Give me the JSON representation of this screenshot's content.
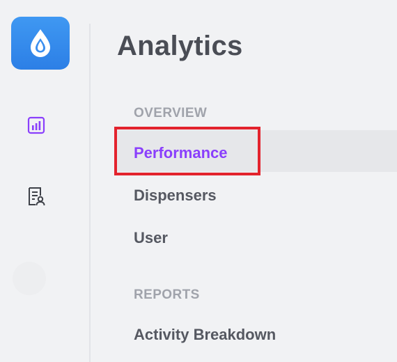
{
  "rail": {
    "icons": [
      {
        "name": "droplet-logo-icon"
      },
      {
        "name": "analytics-chart-icon",
        "color": "#8a3ffc"
      },
      {
        "name": "report-user-icon"
      }
    ]
  },
  "nav": {
    "title": "Analytics",
    "sections": [
      {
        "header": "OVERVIEW",
        "items": [
          {
            "label": "Performance",
            "active": true
          },
          {
            "label": "Dispensers"
          },
          {
            "label": "User"
          }
        ]
      },
      {
        "header": "REPORTS",
        "items": [
          {
            "label": "Activity Breakdown"
          }
        ]
      }
    ]
  },
  "colors": {
    "accent": "#8a3ffc",
    "logo": "#3b8fef",
    "highlight": "#e3232d"
  }
}
